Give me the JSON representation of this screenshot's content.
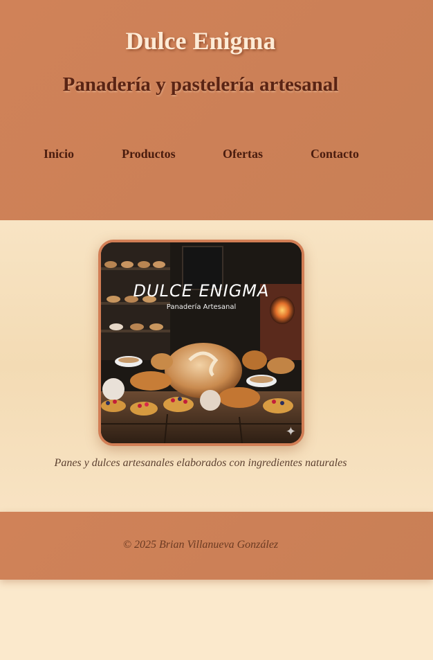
{
  "header": {
    "site_title": "Dulce Enigma",
    "tagline": "Panadería y pastelería artesanal"
  },
  "nav": {
    "items": [
      {
        "label": "Inicio"
      },
      {
        "label": "Productos"
      },
      {
        "label": "Ofertas"
      },
      {
        "label": "Contacto"
      }
    ]
  },
  "hero": {
    "image_brand_text": "DULCE ENIGMA",
    "image_sub_text": "Panadería Artesanal",
    "image_alt": "Dulce Enigma - Panadería Artesanal",
    "caption": "Panes y dulces artesanales elaborados con ingredientes naturales"
  },
  "footer": {
    "copyright": "© 2025 Brian Villanueva González"
  },
  "colors": {
    "header_bg": "#cd8157",
    "body_bg": "#f8e4c4",
    "title_text": "#fdebd6",
    "tagline_text": "#5a2414",
    "nav_text": "#4a1c0e",
    "frame_border": "#d27e55"
  }
}
